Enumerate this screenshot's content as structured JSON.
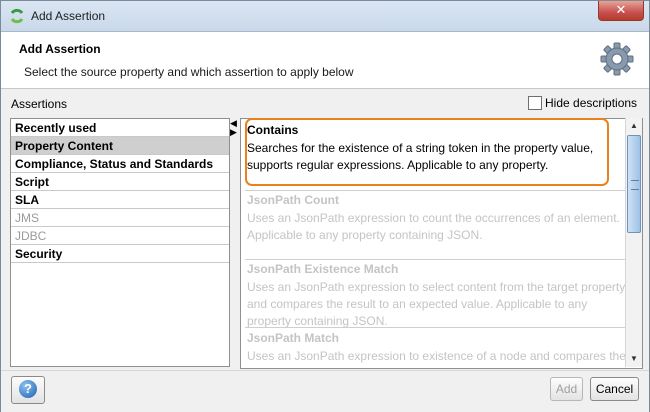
{
  "window": {
    "title": "Add Assertion",
    "close_label": "✕"
  },
  "header": {
    "title": "Add Assertion",
    "subtitle": "Select the source property and which assertion to apply below",
    "icon": "gear-icon"
  },
  "assertions_label": "Assertions",
  "hide_descriptions": {
    "label": "Hide descriptions",
    "checked": false
  },
  "categories": [
    {
      "label": "Recently used",
      "state": "normal"
    },
    {
      "label": "Property Content",
      "state": "selected"
    },
    {
      "label": "Compliance, Status and Standards",
      "state": "normal"
    },
    {
      "label": "Script",
      "state": "normal"
    },
    {
      "label": "SLA",
      "state": "normal"
    },
    {
      "label": "JMS",
      "state": "disabled"
    },
    {
      "label": "JDBC",
      "state": "disabled"
    },
    {
      "label": "Security",
      "state": "normal"
    }
  ],
  "assertion_list": [
    {
      "title": "Contains",
      "description": "Searches for the existence of a string token in the property value, supports regular expressions. Applicable to any property.",
      "enabled": true
    },
    {
      "title": "JsonPath Count",
      "description": "Uses an JsonPath expression to count the occurrences of an element. Applicable to any property containing JSON.",
      "enabled": false
    },
    {
      "title": "JsonPath Existence Match",
      "description": "Uses an JsonPath expression to select content from the target property and compares the result to an expected value. Applicable to any property containing JSON.",
      "enabled": false
    },
    {
      "title": "JsonPath Match",
      "description": "Uses an JsonPath expression to existence of a node and compares the",
      "enabled": false
    }
  ],
  "footer": {
    "help_label": "?",
    "add_label": "Add",
    "cancel_label": "Cancel"
  },
  "colors": {
    "highlight": "#e8821e",
    "selected_row": "#cfcfcf"
  }
}
